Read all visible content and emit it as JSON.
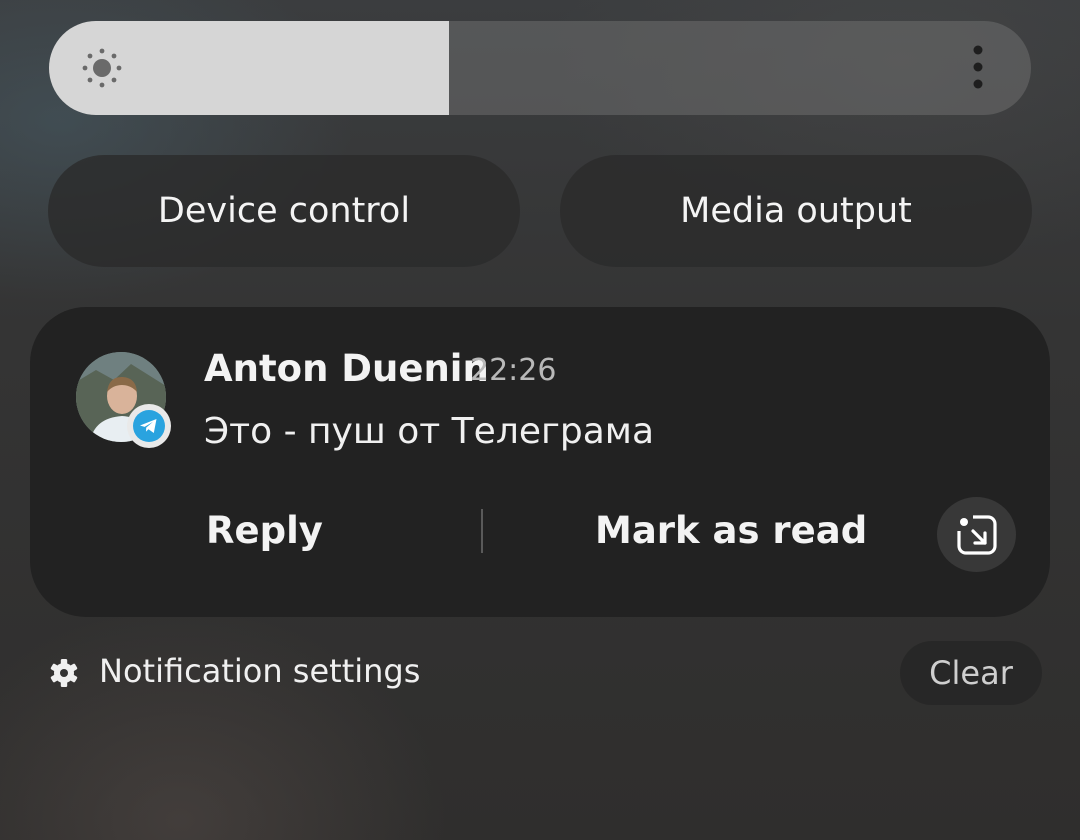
{
  "brightness": {
    "level_fraction": 0.407,
    "sun_icon": "sun-icon",
    "more_icon": "more-vertical-icon"
  },
  "quick_buttons": {
    "device_control_label": "Device control",
    "media_output_label": "Media output"
  },
  "notification": {
    "sender": "Anton Duenin",
    "time": "22:26",
    "message": "Это - пуш от Телеграма",
    "app_badge_icon": "telegram-icon",
    "actions": {
      "reply_label": "Reply",
      "mark_read_label": "Mark as read",
      "open_icon": "open-in-app-icon"
    }
  },
  "footer": {
    "settings_icon": "gear-icon",
    "settings_label": "Notification settings",
    "clear_label": "Clear"
  },
  "colors": {
    "telegram_blue": "#2aa3df",
    "brightness_fill": "#d6d6d6"
  }
}
